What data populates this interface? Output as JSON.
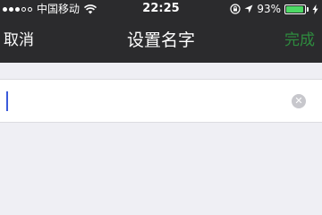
{
  "status_bar": {
    "signal_dots_filled": 3,
    "signal_dots_total": 5,
    "carrier": "中国移动",
    "wifi_icon": "wifi-icon",
    "time": "22:25",
    "orientation_lock_icon": "orientation-lock-icon",
    "location_icon": "location-arrow-icon",
    "battery_percent": "93%",
    "battery_level": 0.93,
    "charging_icon": "charging-bolt-icon"
  },
  "navbar": {
    "cancel_label": "取消",
    "title": "设置名字",
    "done_label": "完成",
    "done_color": "#2e8b3e"
  },
  "name_field": {
    "value": "",
    "clear_icon": "clear-circle-icon"
  },
  "colors": {
    "bar_background": "#2b2b2d",
    "page_background": "#efeff4",
    "battery_green": "#4cd964"
  }
}
